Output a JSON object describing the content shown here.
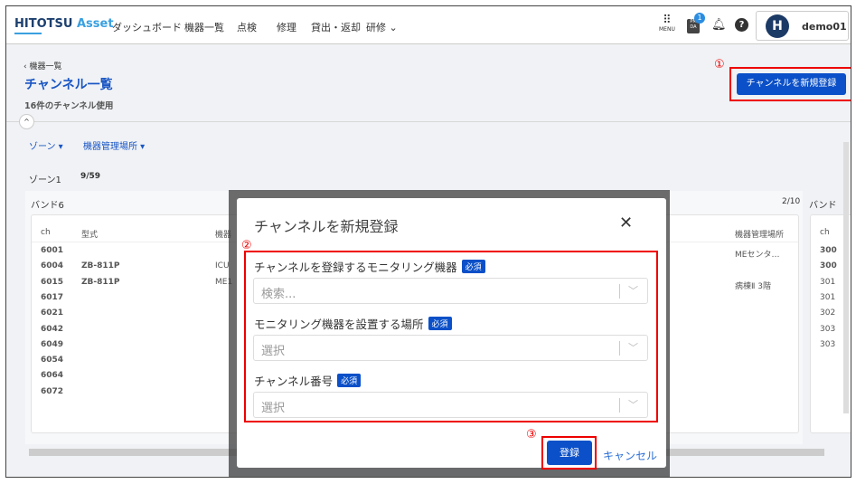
{
  "header": {
    "logo_main": "HITOTSU",
    "logo_accent": "Asset",
    "nav": [
      "ダッシュボード",
      "機器一覧",
      "点検",
      "修理",
      "貸出・返却",
      "研修"
    ],
    "menu_label": "MENU",
    "pmda_label": "PM DA",
    "pmda_badge": "1",
    "user_initial": "H",
    "user_name": "demo01"
  },
  "page": {
    "breadcrumb": "機器一覧",
    "title": "チャンネル一覧",
    "subtitle": "16件のチャンネル使用",
    "new_button": "チャンネルを新規登録",
    "filters": [
      "ゾーン",
      "機器管理場所"
    ],
    "zone_label": "ゾーン1",
    "zone_count": "9/59",
    "accent": "#0b50c8"
  },
  "band6": {
    "title": "バンド6",
    "columns": [
      "ch",
      "型式",
      "機器"
    ],
    "rows": [
      {
        "ch": "6001",
        "model": "",
        "device": "",
        "link": false
      },
      {
        "ch": "6004",
        "model": "ZB-811P",
        "device": "ICU",
        "link": true
      },
      {
        "ch": "6015",
        "model": "ZB-811P",
        "device": "ME1",
        "link": true
      },
      {
        "ch": "6017"
      },
      {
        "ch": "6021"
      },
      {
        "ch": "6042"
      },
      {
        "ch": "6049"
      },
      {
        "ch": "6054"
      },
      {
        "ch": "6064"
      },
      {
        "ch": "6072"
      }
    ]
  },
  "band_mid": {
    "count": "2/10",
    "column": "機器管理場所",
    "locations": [
      "MEセンタ…",
      "",
      "病棟Ⅱ 3階"
    ]
  },
  "band3": {
    "title": "バンド",
    "column": "ch",
    "rows": [
      {
        "ch": "300",
        "link": true
      },
      {
        "ch": "300",
        "link": true
      },
      {
        "ch": "301"
      },
      {
        "ch": "301"
      },
      {
        "ch": "302"
      },
      {
        "ch": "303"
      },
      {
        "ch": "303"
      }
    ]
  },
  "modal": {
    "title": "チャンネルを新規登録",
    "required": "必須",
    "fields": [
      {
        "label": "チャンネルを登録するモニタリング機器",
        "placeholder": "検索..."
      },
      {
        "label": "モニタリング機器を設置する場所",
        "placeholder": "選択"
      },
      {
        "label": "チャンネル番号",
        "placeholder": "選択"
      }
    ],
    "submit": "登録",
    "cancel": "キャンセル"
  },
  "annotations": [
    "①",
    "②",
    "③"
  ]
}
